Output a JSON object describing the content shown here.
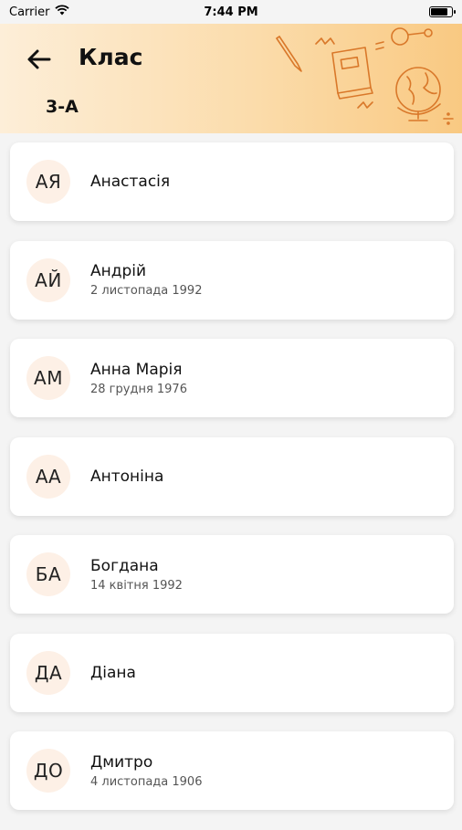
{
  "status": {
    "carrier": "Carrier",
    "time": "7:44 PM",
    "battery_fraction": 0.92
  },
  "header": {
    "title": "Клас",
    "subtitle": "3-А"
  },
  "students": [
    {
      "initials": "АЯ",
      "name": "Анастасія",
      "date": ""
    },
    {
      "initials": "АЙ",
      "name": "Андрій",
      "date": "2 листопада 1992"
    },
    {
      "initials": "АМ",
      "name": "Анна Марія",
      "date": "28 грудня 1976"
    },
    {
      "initials": "АА",
      "name": "Антоніна",
      "date": ""
    },
    {
      "initials": "БА",
      "name": "Богдана",
      "date": "14 квітня 1992"
    },
    {
      "initials": "ДА",
      "name": "Діана",
      "date": ""
    },
    {
      "initials": "ДО",
      "name": "Дмитро",
      "date": "4 листопада 1906"
    }
  ],
  "colors": {
    "header_start": "#fdeed8",
    "header_end": "#f9c982",
    "accent": "#e87722",
    "avatar_bg": "#fdf0e6"
  }
}
